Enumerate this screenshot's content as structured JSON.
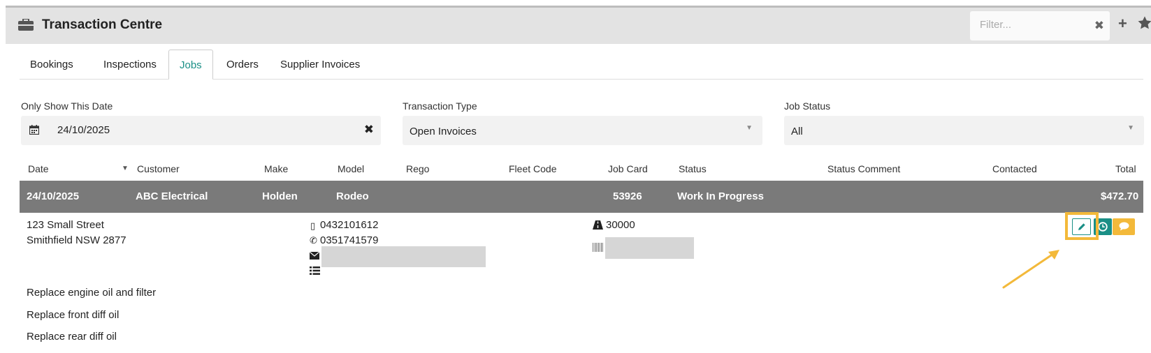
{
  "header": {
    "title": "Transaction Centre",
    "filter_placeholder": "Filter...",
    "filter_clear": "✖",
    "add_label": "+"
  },
  "tabs": [
    {
      "label": "Bookings",
      "active": false
    },
    {
      "label": "Inspections",
      "active": false
    },
    {
      "label": "Jobs",
      "active": true
    },
    {
      "label": "Orders",
      "active": false
    },
    {
      "label": "Supplier Invoices",
      "active": false
    }
  ],
  "filters": {
    "date": {
      "label": "Only Show This Date",
      "value": "24/10/2025",
      "clear": "✖"
    },
    "transaction_type": {
      "label": "Transaction Type",
      "value": "Open Invoices"
    },
    "job_status": {
      "label": "Job Status",
      "value": "All"
    }
  },
  "table": {
    "columns": [
      "Date",
      "Customer",
      "Make",
      "Model",
      "Rego",
      "Fleet Code",
      "Job Card",
      "Status",
      "Status Comment",
      "Contacted",
      "Total"
    ],
    "row": {
      "date": "24/10/2025",
      "customer": "ABC Electrical",
      "make": "Holden",
      "model": "Rodeo",
      "rego": "",
      "fleet_code": "",
      "job_card": "53926",
      "status": "Work In Progress",
      "status_comment": "",
      "contacted": "",
      "total": "$472.70"
    }
  },
  "details": {
    "address_line1": "123 Small Street",
    "address_line2": "Smithfield NSW 2877",
    "mobile": "0432101612",
    "phone": "0351741579",
    "odometer": "30000",
    "tasks": [
      "Replace engine oil and filter",
      "Replace front diff oil",
      "Replace rear diff oil"
    ]
  },
  "colors": {
    "accent": "#1a8f86",
    "highlight": "#f3b93a",
    "row_bg": "#7a7a7a",
    "header_bg": "#e3e3e3"
  },
  "icons": [
    "briefcase-icon",
    "close-icon",
    "plus-icon",
    "star-icon",
    "calendar-icon",
    "caret-down-icon",
    "mobile-icon",
    "phone-icon",
    "envelope-icon",
    "list-icon",
    "road-icon",
    "barcode-icon",
    "pencil-icon",
    "clock-icon",
    "comment-icon"
  ]
}
